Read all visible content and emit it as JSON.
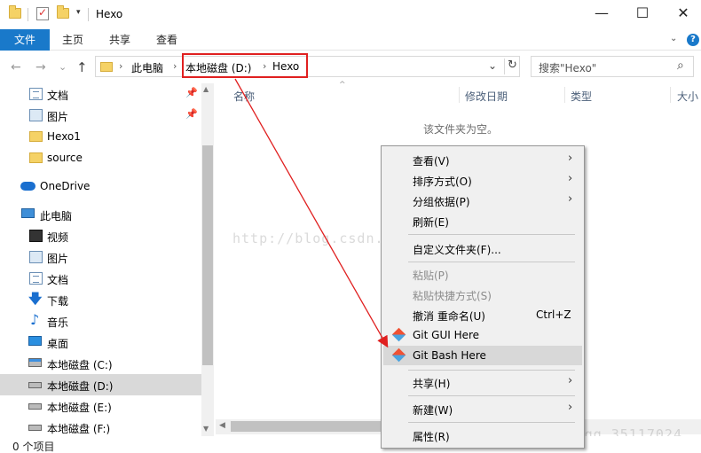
{
  "window": {
    "title": "Hexo",
    "minimize_glyph": "—",
    "maximize_glyph": "☐",
    "close_glyph": "✕"
  },
  "quick_access": {
    "dropdown_glyph": "▾"
  },
  "ribbon": {
    "file_tab": "文件",
    "tabs": [
      "主页",
      "共享",
      "查看"
    ],
    "chevron": "⌄",
    "help": "?"
  },
  "navigation": {
    "back": "←",
    "forward": "→",
    "recent": "⌄",
    "up": "↑",
    "breadcrumb": [
      "此电脑",
      "本地磁盘 (D:)",
      "Hexo"
    ],
    "crumb_sep": "›",
    "address_dropdown": "⌄",
    "refresh": "↻"
  },
  "search": {
    "placeholder": "搜索\"Hexo\"",
    "icon": "⌕"
  },
  "navpane": {
    "items": [
      {
        "label": "文档",
        "icon": "documents-icon",
        "pinned": true
      },
      {
        "label": "图片",
        "icon": "pictures-icon",
        "pinned": true
      },
      {
        "label": "Hexo1",
        "icon": "folder-icon"
      },
      {
        "label": "source",
        "icon": "folder-icon"
      },
      {
        "label": "OneDrive",
        "icon": "onedrive-icon"
      },
      {
        "label": "此电脑",
        "icon": "this-pc-icon"
      },
      {
        "label": "视频",
        "icon": "videos-icon"
      },
      {
        "label": "图片",
        "icon": "pictures-icon"
      },
      {
        "label": "文档",
        "icon": "documents-icon"
      },
      {
        "label": "下载",
        "icon": "downloads-icon"
      },
      {
        "label": "音乐",
        "icon": "music-icon"
      },
      {
        "label": "桌面",
        "icon": "desktop-icon"
      },
      {
        "label": "本地磁盘 (C:)",
        "icon": "drive-c-icon"
      },
      {
        "label": "本地磁盘 (D:)",
        "icon": "drive-icon",
        "selected": true
      },
      {
        "label": "本地磁盘 (E:)",
        "icon": "drive-icon"
      },
      {
        "label": "本地磁盘 (F:)",
        "icon": "drive-icon"
      }
    ],
    "pin_glyph": "📌",
    "download_glyph": "🡇",
    "music_glyph": "♪"
  },
  "content": {
    "columns": [
      "名称",
      "修改日期",
      "类型",
      "大小"
    ],
    "sort_glyph": "^",
    "empty_message": "该文件夹为空。"
  },
  "scroll": {
    "up": "▲",
    "down": "▼",
    "left": "◀"
  },
  "status": {
    "items_count": "0 个项目"
  },
  "watermarks": [
    "http://blog.csdn.net/qq_35117024",
    "http://blog.csdn.net/qq_35117024"
  ],
  "context_menu": {
    "items": [
      {
        "label": "查看(V)",
        "submenu": true
      },
      {
        "label": "排序方式(O)",
        "submenu": true
      },
      {
        "label": "分组依据(P)",
        "submenu": true
      },
      {
        "label": "刷新(E)"
      },
      {
        "label": "自定义文件夹(F)..."
      },
      {
        "label": "粘贴(P)",
        "disabled": true
      },
      {
        "label": "粘贴快捷方式(S)",
        "disabled": true
      },
      {
        "label": "撤消 重命名(U)",
        "shortcut": "Ctrl+Z"
      },
      {
        "label": "Git GUI Here",
        "icon": "git-icon"
      },
      {
        "label": "Git Bash Here",
        "icon": "git-icon",
        "highlighted": true
      },
      {
        "label": "共享(H)",
        "submenu": true
      },
      {
        "label": "新建(W)",
        "submenu": true
      },
      {
        "label": "属性(R)"
      }
    ],
    "submenu_glyph": "›"
  },
  "colors": {
    "accent": "#1979ca",
    "annotation": "#e02020"
  }
}
